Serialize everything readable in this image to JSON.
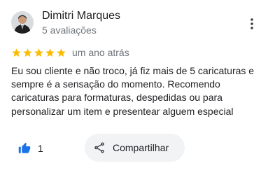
{
  "reviewer": {
    "name": "Dimitri Marques",
    "review_count": "5 avaliações",
    "avatar_icon": "person-photo-avatar"
  },
  "menu": {
    "icon": "more-vert-icon"
  },
  "rating": {
    "stars": 5,
    "max_stars": 5,
    "star_color": "#fbbc04",
    "date": "um ano atrás"
  },
  "review": {
    "text": "Eu sou cliente e não troco, já fiz mais de 5 caricaturas e sempre é a sensação do momento. Recomendo caricaturas para formaturas, despedidas ou para personalizar um item e presentear alguem especial"
  },
  "actions": {
    "like_icon": "thumb-up-icon",
    "like_color": "#1a73e8",
    "like_count": "1",
    "share_icon": "share-icon",
    "share_label": "Compartilhar"
  }
}
